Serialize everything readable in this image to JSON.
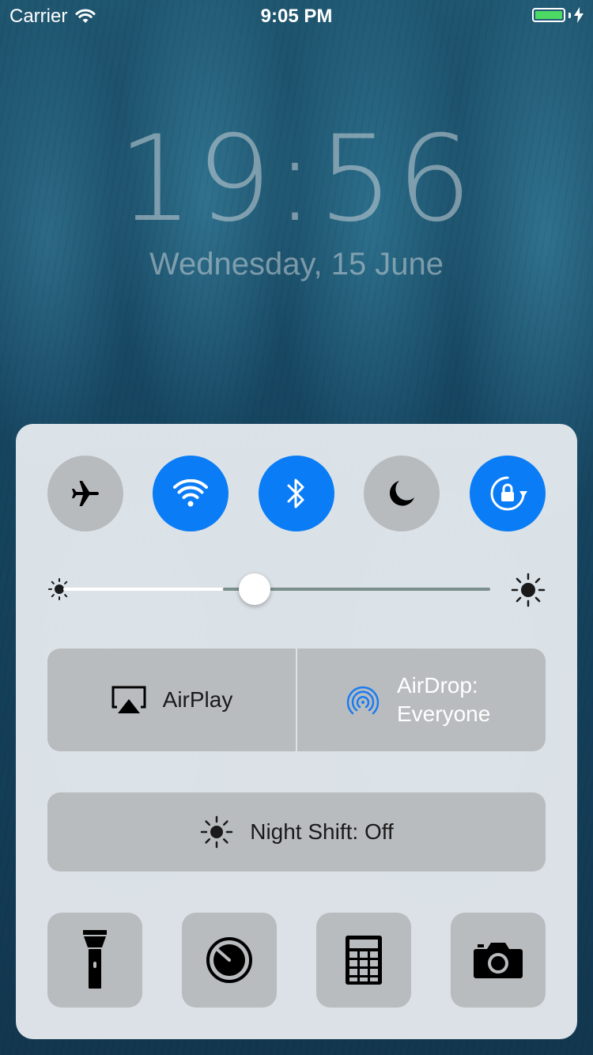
{
  "status_bar": {
    "carrier": "Carrier",
    "time": "9:05 PM",
    "battery_level": 1.0,
    "battery_color": "#4cd964",
    "icons": [
      "wifi-icon",
      "battery-icon",
      "charging-bolt-icon"
    ]
  },
  "lock_screen": {
    "time": "19:56",
    "date": "Wednesday, 15 June"
  },
  "control_center": {
    "toggles": [
      {
        "name": "airplane-mode",
        "icon": "airplane-icon",
        "on": false
      },
      {
        "name": "wifi",
        "icon": "wifi-icon",
        "on": true
      },
      {
        "name": "bluetooth",
        "icon": "bluetooth-icon",
        "on": true
      },
      {
        "name": "do-not-disturb",
        "icon": "moon-icon",
        "on": false
      },
      {
        "name": "rotation-lock",
        "icon": "rotation-lock-icon",
        "on": true
      }
    ],
    "accent_color": "#0a7cf5",
    "brightness_level": 0.4,
    "airplay_label": "AirPlay",
    "airdrop_label": "AirDrop:",
    "airdrop_value": "Everyone",
    "night_shift_label": "Night Shift: Off",
    "tools": [
      {
        "name": "flashlight",
        "icon": "flashlight-icon"
      },
      {
        "name": "timer",
        "icon": "timer-icon"
      },
      {
        "name": "calculator",
        "icon": "calculator-icon"
      },
      {
        "name": "camera",
        "icon": "camera-icon"
      }
    ]
  }
}
